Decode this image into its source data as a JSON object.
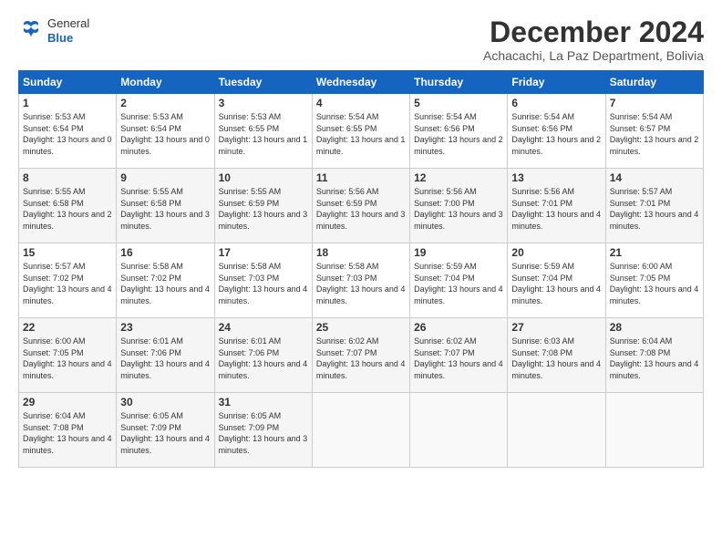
{
  "header": {
    "logo": {
      "general": "General",
      "blue": "Blue"
    },
    "title": "December 2024",
    "location": "Achacachi, La Paz Department, Bolivia"
  },
  "days": [
    "Sunday",
    "Monday",
    "Tuesday",
    "Wednesday",
    "Thursday",
    "Friday",
    "Saturday"
  ],
  "weeks": [
    [
      {
        "day": "1",
        "sunrise": "5:53 AM",
        "sunset": "6:54 PM",
        "daylight": "13 hours and 0 minutes."
      },
      {
        "day": "2",
        "sunrise": "5:53 AM",
        "sunset": "6:54 PM",
        "daylight": "13 hours and 0 minutes."
      },
      {
        "day": "3",
        "sunrise": "5:53 AM",
        "sunset": "6:55 PM",
        "daylight": "13 hours and 1 minute."
      },
      {
        "day": "4",
        "sunrise": "5:54 AM",
        "sunset": "6:55 PM",
        "daylight": "13 hours and 1 minute."
      },
      {
        "day": "5",
        "sunrise": "5:54 AM",
        "sunset": "6:56 PM",
        "daylight": "13 hours and 2 minutes."
      },
      {
        "day": "6",
        "sunrise": "5:54 AM",
        "sunset": "6:56 PM",
        "daylight": "13 hours and 2 minutes."
      },
      {
        "day": "7",
        "sunrise": "5:54 AM",
        "sunset": "6:57 PM",
        "daylight": "13 hours and 2 minutes."
      }
    ],
    [
      {
        "day": "8",
        "sunrise": "5:55 AM",
        "sunset": "6:58 PM",
        "daylight": "13 hours and 2 minutes."
      },
      {
        "day": "9",
        "sunrise": "5:55 AM",
        "sunset": "6:58 PM",
        "daylight": "13 hours and 3 minutes."
      },
      {
        "day": "10",
        "sunrise": "5:55 AM",
        "sunset": "6:59 PM",
        "daylight": "13 hours and 3 minutes."
      },
      {
        "day": "11",
        "sunrise": "5:56 AM",
        "sunset": "6:59 PM",
        "daylight": "13 hours and 3 minutes."
      },
      {
        "day": "12",
        "sunrise": "5:56 AM",
        "sunset": "7:00 PM",
        "daylight": "13 hours and 3 minutes."
      },
      {
        "day": "13",
        "sunrise": "5:56 AM",
        "sunset": "7:01 PM",
        "daylight": "13 hours and 4 minutes."
      },
      {
        "day": "14",
        "sunrise": "5:57 AM",
        "sunset": "7:01 PM",
        "daylight": "13 hours and 4 minutes."
      }
    ],
    [
      {
        "day": "15",
        "sunrise": "5:57 AM",
        "sunset": "7:02 PM",
        "daylight": "13 hours and 4 minutes."
      },
      {
        "day": "16",
        "sunrise": "5:58 AM",
        "sunset": "7:02 PM",
        "daylight": "13 hours and 4 minutes."
      },
      {
        "day": "17",
        "sunrise": "5:58 AM",
        "sunset": "7:03 PM",
        "daylight": "13 hours and 4 minutes."
      },
      {
        "day": "18",
        "sunrise": "5:58 AM",
        "sunset": "7:03 PM",
        "daylight": "13 hours and 4 minutes."
      },
      {
        "day": "19",
        "sunrise": "5:59 AM",
        "sunset": "7:04 PM",
        "daylight": "13 hours and 4 minutes."
      },
      {
        "day": "20",
        "sunrise": "5:59 AM",
        "sunset": "7:04 PM",
        "daylight": "13 hours and 4 minutes."
      },
      {
        "day": "21",
        "sunrise": "6:00 AM",
        "sunset": "7:05 PM",
        "daylight": "13 hours and 4 minutes."
      }
    ],
    [
      {
        "day": "22",
        "sunrise": "6:00 AM",
        "sunset": "7:05 PM",
        "daylight": "13 hours and 4 minutes."
      },
      {
        "day": "23",
        "sunrise": "6:01 AM",
        "sunset": "7:06 PM",
        "daylight": "13 hours and 4 minutes."
      },
      {
        "day": "24",
        "sunrise": "6:01 AM",
        "sunset": "7:06 PM",
        "daylight": "13 hours and 4 minutes."
      },
      {
        "day": "25",
        "sunrise": "6:02 AM",
        "sunset": "7:07 PM",
        "daylight": "13 hours and 4 minutes."
      },
      {
        "day": "26",
        "sunrise": "6:02 AM",
        "sunset": "7:07 PM",
        "daylight": "13 hours and 4 minutes."
      },
      {
        "day": "27",
        "sunrise": "6:03 AM",
        "sunset": "7:08 PM",
        "daylight": "13 hours and 4 minutes."
      },
      {
        "day": "28",
        "sunrise": "6:04 AM",
        "sunset": "7:08 PM",
        "daylight": "13 hours and 4 minutes."
      }
    ],
    [
      {
        "day": "29",
        "sunrise": "6:04 AM",
        "sunset": "7:08 PM",
        "daylight": "13 hours and 4 minutes."
      },
      {
        "day": "30",
        "sunrise": "6:05 AM",
        "sunset": "7:09 PM",
        "daylight": "13 hours and 4 minutes."
      },
      {
        "day": "31",
        "sunrise": "6:05 AM",
        "sunset": "7:09 PM",
        "daylight": "13 hours and 3 minutes."
      },
      null,
      null,
      null,
      null
    ]
  ]
}
